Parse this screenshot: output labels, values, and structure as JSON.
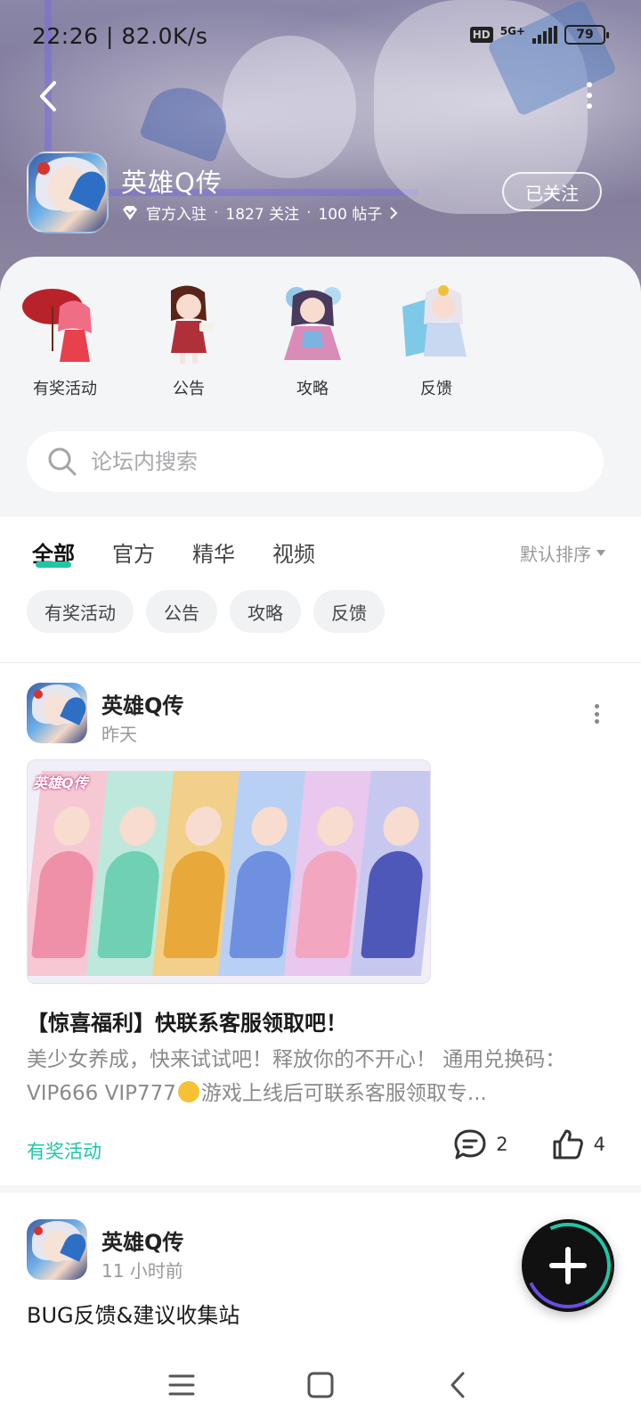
{
  "status_bar": {
    "time": "22:26 | 82.0K/s",
    "hd_label": "HD",
    "network_label": "5G+",
    "battery": "79"
  },
  "header": {
    "game_name": "英雄Q传",
    "verified_label": "官方入驻",
    "followers": "1827 关注",
    "posts": "100 帖子",
    "follow_button": "已关注"
  },
  "quick_links": [
    {
      "label": "有奖活动"
    },
    {
      "label": "公告"
    },
    {
      "label": "攻略"
    },
    {
      "label": "反馈"
    }
  ],
  "search": {
    "placeholder": "论坛内搜索"
  },
  "tabs": [
    {
      "label": "全部",
      "active": true
    },
    {
      "label": "官方"
    },
    {
      "label": "精华"
    },
    {
      "label": "视频"
    }
  ],
  "sort_label": "默认排序",
  "chips": [
    "有奖活动",
    "公告",
    "攻略",
    "反馈"
  ],
  "posts": [
    {
      "author": "英雄Q传",
      "time": "昨天",
      "image_title": "英雄Q传",
      "title": "【惊喜福利】快联系客服领取吧！",
      "excerpt_a": "美少女养成，快来试试吧！释放你的不开心！ 通用兑换码： VIP666 VIP777",
      "excerpt_b": "游戏上线后可联系客服领取专...",
      "tag": "有奖活动",
      "comments": "2",
      "likes": "4"
    },
    {
      "author": "英雄Q传",
      "time": "11 小时前",
      "title": "BUG反馈&建议收集站"
    }
  ],
  "colors": {
    "accent": "#1fc6a6",
    "banner": "#8a86a8",
    "panel_bg": "#f4f5f7"
  }
}
